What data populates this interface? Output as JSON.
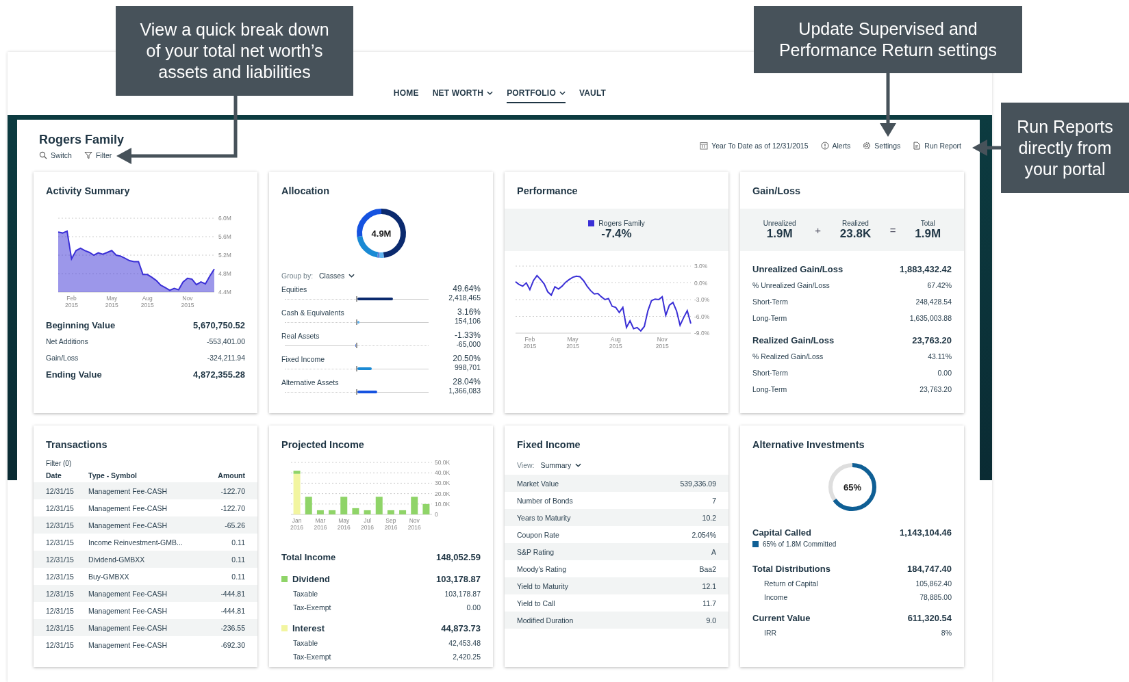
{
  "callouts": [
    {
      "text": "View a quick break down of your total net worth’s assets and liabilities"
    },
    {
      "text": "Update Supervised and Performance Return settings"
    },
    {
      "text": "Run Reports directly from your portal"
    }
  ],
  "nav": [
    {
      "label": "HOME",
      "dropdown": false,
      "selected": false
    },
    {
      "label": "NET WORTH",
      "dropdown": true,
      "selected": false
    },
    {
      "label": "PORTFOLIO",
      "dropdown": true,
      "selected": true
    },
    {
      "label": "VAULT",
      "dropdown": false,
      "selected": false
    }
  ],
  "account": {
    "name": "Rogers Family",
    "actions": [
      {
        "kind": "switch",
        "label": "Switch"
      },
      {
        "kind": "filter",
        "label": "Filter"
      }
    ]
  },
  "toolbar": [
    {
      "kind": "calendar",
      "label": "Year To Date as of 12/31/2015"
    },
    {
      "kind": "alert",
      "label": "Alerts"
    },
    {
      "kind": "settings",
      "label": "Settings"
    },
    {
      "kind": "report",
      "label": "Run Report"
    }
  ],
  "activity_summary": {
    "title": "Activity Summary",
    "chart_data": {
      "type": "area",
      "grid": true,
      "categories": [
        null,
        null,
        null,
        "Feb 2015",
        null,
        null,
        null,
        null,
        null,
        null,
        null,
        null,
        "May 2015",
        null,
        null,
        null,
        null,
        null,
        null,
        null,
        "Aug 2015",
        null,
        null,
        null,
        null,
        null,
        null,
        null,
        null,
        "Nov 2015",
        null,
        null,
        null,
        null,
        null,
        null
      ],
      "series": [
        {
          "color": "#3a2fd6",
          "values": [
            5.7,
            5.68,
            5.72,
            5.12,
            5.3,
            5.35,
            5.3,
            5.26,
            5.2,
            5.25,
            5.22,
            5.26,
            5.3,
            5.2,
            5.18,
            5.13,
            5.08,
            5.06,
            5.06,
            4.78,
            4.78,
            4.72,
            4.65,
            4.55,
            4.5,
            4.44,
            4.48,
            4.45,
            4.62,
            4.7,
            4.68,
            4.56,
            4.62,
            4.58,
            4.75,
            4.9
          ]
        }
      ],
      "ylim": [
        4.4,
        6.0
      ],
      "yticks": [
        {
          "value": 6.0,
          "label": "6.0M"
        },
        {
          "value": 5.6,
          "label": "5.6M"
        },
        {
          "value": 5.2,
          "label": "5.2M"
        },
        {
          "value": 4.8,
          "label": "4.8M"
        },
        {
          "value": 4.4,
          "label": "4.4M"
        }
      ]
    },
    "rows": [
      {
        "kind": "total",
        "label": "Beginning Value",
        "value": "5,670,750.52"
      },
      {
        "kind": "detail",
        "label": "Net Additions",
        "value": "-553,401.00"
      },
      {
        "kind": "detail",
        "label": "Gain/Loss",
        "value": "-324,211.94"
      },
      {
        "kind": "total",
        "label": "Ending Value",
        "value": "4,872,355.28"
      }
    ]
  },
  "allocation": {
    "title": "Allocation",
    "total": "4.9M",
    "group_by": {
      "label": "Group by:",
      "value": "Classes"
    },
    "items": [
      {
        "name": "Equities",
        "percent": "49.64%",
        "amount": "2,418,465",
        "level": 0.4964,
        "negative": false,
        "color": "#0b2a6e"
      },
      {
        "name": "Cash & Equivalents",
        "percent": "3.16%",
        "amount": "154,106",
        "level": 0.0316,
        "negative": false,
        "color": "#5fb3f0"
      },
      {
        "name": "Real Assets",
        "percent": "-1.33%",
        "amount": "-65,000",
        "level": 0.0133,
        "negative": true,
        "color": "#5b7fd8"
      },
      {
        "name": "Fixed Income",
        "percent": "20.50%",
        "amount": "998,701",
        "level": 0.205,
        "negative": false,
        "color": "#1a8ad4"
      },
      {
        "name": "Alternative Assets",
        "percent": "28.04%",
        "amount": "1,366,083",
        "level": 0.2804,
        "negative": false,
        "color": "#1552e0"
      }
    ]
  },
  "performance": {
    "title": "Performance",
    "legend_value": "-7.4%",
    "chart_data": {
      "type": "line",
      "grid": true,
      "categories": [
        null,
        null,
        null,
        null,
        "Feb 2015",
        null,
        null,
        null,
        null,
        null,
        null,
        null,
        null,
        null,
        null,
        null,
        "May 2015",
        null,
        null,
        null,
        null,
        null,
        null,
        null,
        null,
        null,
        null,
        null,
        "Aug 2015",
        null,
        null,
        null,
        null,
        null,
        null,
        null,
        null,
        null,
        null,
        null,
        null,
        "Nov 2015",
        null,
        null,
        null,
        null,
        null,
        null,
        null,
        null
      ],
      "series": [
        {
          "name": "Rogers Family",
          "color": "#3a2fd6",
          "values": [
            0.2,
            -0.3,
            -0.6,
            0,
            -1.2,
            0.4,
            1.3,
            0.6,
            -0.2,
            -1.6,
            -2.2,
            -0.7,
            -1.1,
            -0.6,
            0.1,
            0.6,
            1.0,
            1.2,
            1.1,
            0.4,
            -0.6,
            -1.4,
            -2.0,
            -1.9,
            -2.5,
            -3.0,
            -2.8,
            -4.2,
            -4.4,
            -5.3,
            -4.4,
            -8.0,
            -6.8,
            -8.2,
            -8.0,
            -8.6,
            -7.8,
            -5.0,
            -3.2,
            -2.9,
            -3.0,
            -2.5,
            -5.8,
            -4.0,
            -3.5,
            -5.0,
            -7.6,
            -6.2,
            -5.0,
            -7.3
          ]
        }
      ],
      "ylim": [
        -9,
        3
      ],
      "yticks": [
        {
          "value": 3,
          "label": "3.0%"
        },
        {
          "value": 0,
          "label": "0.0%"
        },
        {
          "value": -3,
          "label": "-3.0%"
        },
        {
          "value": -6,
          "label": "-6.0%"
        },
        {
          "value": -9,
          "label": "-9.0%"
        }
      ]
    }
  },
  "gain_loss": {
    "title": "Gain/Loss",
    "summary": [
      {
        "kind": "value",
        "label": "Unrealized",
        "value": "1.9M"
      },
      {
        "kind": "operator",
        "symbol": "+"
      },
      {
        "kind": "value",
        "label": "Realized",
        "value": "23.8K"
      },
      {
        "kind": "operator",
        "symbol": "="
      },
      {
        "kind": "value",
        "label": "Total",
        "value": "1.9M"
      }
    ],
    "sections": [
      {
        "label": "Unrealized Gain/Loss",
        "value": "1,883,432.42",
        "rows": [
          {
            "label": "% Unrealized Gain/Loss",
            "value": "67.42%"
          },
          {
            "label": "Short-Term",
            "value": "248,428.54"
          },
          {
            "label": "Long-Term",
            "value": "1,635,003.88"
          }
        ]
      },
      {
        "label": "Realized Gain/Loss",
        "value": "23,763.20",
        "rows": [
          {
            "label": "% Realized Gain/Loss",
            "value": "43.11%"
          },
          {
            "label": "Short-Term",
            "value": "0.00"
          },
          {
            "label": "Long-Term",
            "value": "23,763.20"
          }
        ]
      }
    ]
  },
  "transactions": {
    "title": "Transactions",
    "filter": "Filter (0)",
    "columns": [
      "Date",
      "Type - Symbol",
      "Amount"
    ],
    "rows": [
      [
        "12/31/15",
        "Management Fee-CASH",
        "-122.70"
      ],
      [
        "12/31/15",
        "Management Fee-CASH",
        "-122.70"
      ],
      [
        "12/31/15",
        "Management Fee-CASH",
        "-65.26"
      ],
      [
        "12/31/15",
        "Income Reinvestment-GMB...",
        "0.11"
      ],
      [
        "12/31/15",
        "Dividend-GMBXX",
        "0.11"
      ],
      [
        "12/31/15",
        "Buy-GMBXX",
        "0.11"
      ],
      [
        "12/31/15",
        "Management Fee-CASH",
        "-444.81"
      ],
      [
        "12/31/15",
        "Management Fee-CASH",
        "-444.81"
      ],
      [
        "12/31/15",
        "Management Fee-CASH",
        "-236.55"
      ],
      [
        "12/31/15",
        "Management Fee-CASH",
        "-692.30"
      ]
    ]
  },
  "projected_income": {
    "title": "Projected Income",
    "chart_data": {
      "type": "bar",
      "stacked": true,
      "grid": true,
      "categories": [
        "Jan 2016",
        null,
        "Mar 2016",
        null,
        "May 2016",
        null,
        "Jul 2016",
        null,
        "Sep 2016",
        null,
        "Nov 2016",
        null
      ],
      "series": [
        {
          "name": "Dividend",
          "color": "#8fd468",
          "values": [
            3,
            17,
            4,
            4,
            17,
            6,
            4,
            17,
            4,
            4,
            17,
            10
          ]
        },
        {
          "name": "Interest",
          "color": "#f2f5a0",
          "values": [
            39,
            null,
            0,
            0,
            0,
            0,
            0,
            null,
            0,
            0,
            0,
            0
          ]
        }
      ],
      "ylim": [
        0,
        50
      ],
      "yticks": [
        {
          "value": 50,
          "label": "50.0K"
        },
        {
          "value": 40,
          "label": "40.0K"
        },
        {
          "value": 30,
          "label": "30.0K"
        },
        {
          "value": 20,
          "label": "20.0K"
        },
        {
          "value": 10,
          "label": "10.0K"
        },
        {
          "value": 0,
          "label": "0"
        }
      ]
    },
    "total": {
      "label": "Total Income",
      "value": "148,052.59"
    },
    "groups": [
      {
        "value": "103,178.87",
        "rows": [
          {
            "label": "Taxable",
            "value": "103,178.87"
          },
          {
            "label": "Tax-Exempt",
            "value": "0.00"
          }
        ]
      },
      {
        "value": "44,873.73",
        "rows": [
          {
            "label": "Taxable",
            "value": "42,453.48"
          },
          {
            "label": "Tax-Exempt",
            "value": "2,420.25"
          }
        ]
      }
    ]
  },
  "fixed_income": {
    "title": "Fixed Income",
    "view": {
      "label": "View:",
      "value": "Summary"
    },
    "rows": [
      {
        "label": "Market Value",
        "value": "539,336.09"
      },
      {
        "label": "Number of Bonds",
        "value": "7"
      },
      {
        "label": "Years to Maturity",
        "value": "10.2"
      },
      {
        "label": "Coupon Rate",
        "value": "2.054%"
      },
      {
        "label": "S&P Rating",
        "value": "A"
      },
      {
        "label": "Moody's Rating",
        "value": "Baa2"
      },
      {
        "label": "Yield to Maturity",
        "value": "12.1"
      },
      {
        "label": "Yield to Call",
        "value": "11.7"
      },
      {
        "label": "Modified Duration",
        "value": "9.0"
      }
    ]
  },
  "alternative_investments": {
    "title": "Alternative Investments",
    "ring": {
      "label": "65%",
      "level": 0.65
    },
    "capital": {
      "label": "Capital Called",
      "value": "1,143,104.46",
      "note": "65% of 1.8M Committed"
    },
    "sections": [
      {
        "label": "Total Distributions",
        "value": "184,747.40",
        "rows": [
          {
            "label": "Return of Capital",
            "value": "105,862.40"
          },
          {
            "label": "Income",
            "value": "78,885.00"
          }
        ]
      },
      {
        "label": "Current Value",
        "value": "611,320.54",
        "rows": [
          {
            "label": "IRR",
            "value": "8%"
          }
        ]
      }
    ]
  }
}
